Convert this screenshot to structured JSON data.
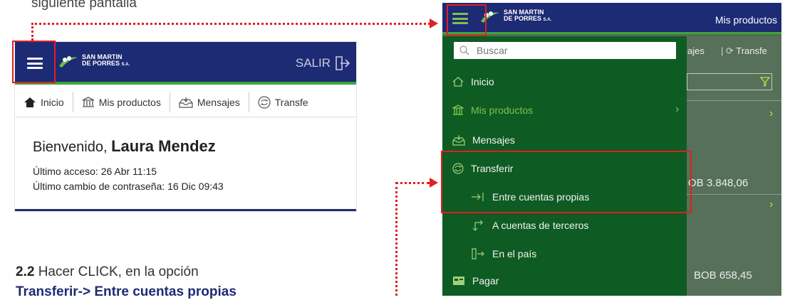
{
  "caption_top": "siguiente pantalla",
  "left_screen": {
    "brand_line1": "SAN MARTIN",
    "brand_line2": "DE PORRES",
    "brand_suffix": "S.A.",
    "salir_label": "SALIR",
    "tabs": [
      "Inicio",
      "Mis productos",
      "Mensajes",
      "Transfe"
    ],
    "welcome_label": "Bienvenido,",
    "user_name": "Laura Mendez",
    "last_access": "Último acceso: 26 Abr 11:15",
    "last_password_change": "Último cambio de contraseña: 16 Dic 09:43"
  },
  "right_screen": {
    "brand_line1": "SAN MARTIN",
    "brand_line2": "DE PORRES",
    "brand_suffix": "S.A.",
    "header_title": "Mis productos",
    "search_placeholder": "Buscar",
    "menu": [
      {
        "label": "Inicio",
        "icon": "home-icon"
      },
      {
        "label": "Mis productos",
        "icon": "bank-icon"
      },
      {
        "label": "Mensajes",
        "icon": "inbox-icon"
      },
      {
        "label": "Transferir",
        "icon": "transfer-icon"
      },
      {
        "label": "Entre cuentas propias",
        "icon": "arrow-right-bar-icon"
      },
      {
        "label": "A cuentas de terceros",
        "icon": "arrow-return-icon"
      },
      {
        "label": "En el país",
        "icon": "door-arrow-icon"
      },
      {
        "label": "Pagar",
        "icon": "pay-icon"
      }
    ],
    "background": {
      "tab_fragment_1": "ajes",
      "tab_fragment_2": "Transfe",
      "balance_1": "OB 3.848,06",
      "balance_2": "BOB 658,45"
    }
  },
  "instruction": {
    "step": "2.2",
    "text": " Hacer CLICK, en la opción",
    "target": "Transferir-> Entre cuentas propias"
  },
  "colors": {
    "header_blue": "#1d2a74",
    "drawer_green": "#0f5b24",
    "highlight_red": "#e02020",
    "accent_green": "#3aa63a"
  }
}
